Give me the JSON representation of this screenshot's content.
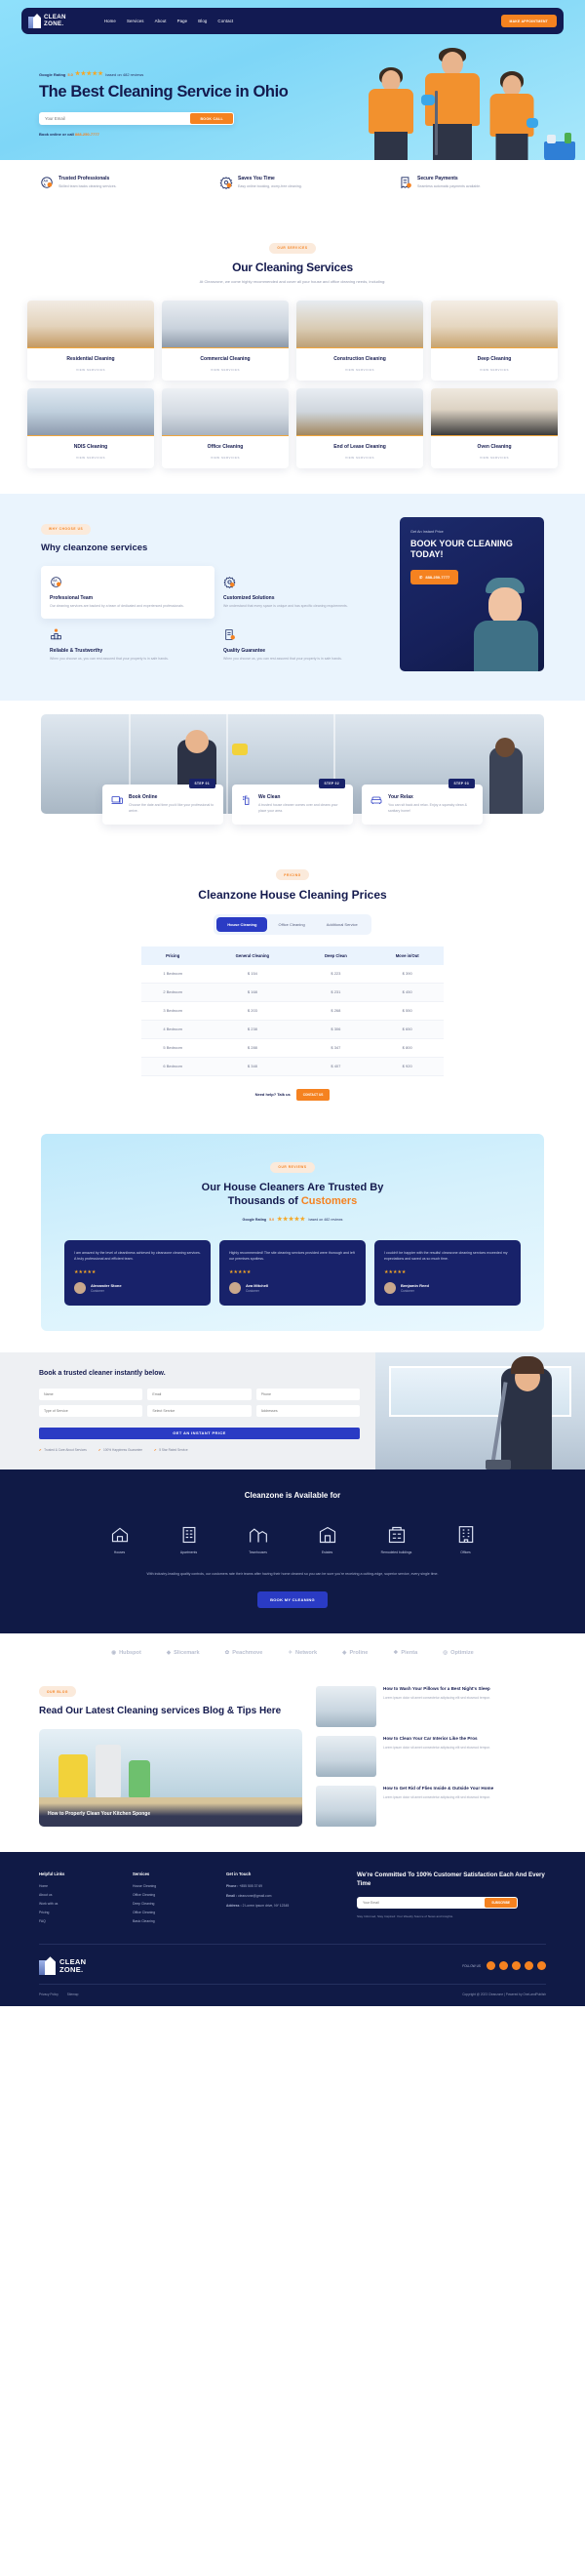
{
  "header": {
    "logo": {
      "line1": "CLEAN",
      "line2": "ZONE."
    },
    "nav": [
      {
        "label": "Home"
      },
      {
        "label": "Services"
      },
      {
        "label": "About"
      },
      {
        "label": "Page"
      },
      {
        "label": "Blog"
      },
      {
        "label": "Contact"
      }
    ],
    "cta": "MAKE APPOINTMENT"
  },
  "hero": {
    "rating_label": "Google Rating",
    "rating_value": "5.0",
    "stars": "★★★★★",
    "rating_sub": "based on 482 reviews",
    "title": "The Best Cleaning Service in Ohio",
    "email_placeholder": "Your Email",
    "book_button": "BOOK CALL",
    "call_prefix": "Book online or call",
    "phone": "888-250-7777"
  },
  "features": [
    {
      "icon": "badge-icon",
      "title": "Trusted Professionals",
      "desc": "Skilled team backs cleaning services."
    },
    {
      "icon": "gear-clock-icon",
      "title": "Saves You Time",
      "desc": "Easy online booking, worry-free cleaning."
    },
    {
      "icon": "receipt-icon",
      "title": "Secure Payments",
      "desc": "Seamless automatic payments available."
    }
  ],
  "services": {
    "pill": "OUR SERVICES",
    "title": "Our Cleaning Services",
    "desc": "At Cleanzone, we come highly recommended and cover all your house and office cleaning needs, including:",
    "view_label": "VIEW SERVICES",
    "items": [
      {
        "title": "Residential Cleaning",
        "thumb": "th-res"
      },
      {
        "title": "Commercial Cleaning",
        "thumb": "th-com"
      },
      {
        "title": "Construction Cleaning",
        "thumb": "th-con"
      },
      {
        "title": "Deep Cleaning",
        "thumb": "th-dep"
      },
      {
        "title": "NDIS Cleaning",
        "thumb": "th-ndis"
      },
      {
        "title": "Office Cleaning",
        "thumb": "th-off"
      },
      {
        "title": "End of Lease Cleaning",
        "thumb": "th-lease"
      },
      {
        "title": "Oven Cleaning",
        "thumb": "th-oven"
      }
    ]
  },
  "why": {
    "pill": "WHY CHOOSE US",
    "title": "Why cleanzone services",
    "items": [
      {
        "icon": "badge-icon",
        "title": "Professional Team",
        "desc": "Our cleaning services are backed by a team of dedicated and experienced professionals."
      },
      {
        "icon": "gear-clock-icon",
        "title": "Customized Solutions",
        "desc": "We understand that every space is unique and has specific cleaning requirements."
      },
      {
        "icon": "podium-icon",
        "title": "Reliable & Trustworthy",
        "desc": "When you choose us, you can rest assured that your property is in safe hands."
      },
      {
        "icon": "certificate-icon",
        "title": "Quality Guarantee",
        "desc": "When you choose us, you can rest assured that your property is in safe hands."
      }
    ],
    "promo": {
      "eyebrow": "Get An Instant Price",
      "title": "BOOK YOUR CLEANING TODAY!",
      "phone": "888-250-7777"
    }
  },
  "steps": [
    {
      "tag": "STEP 01",
      "icon": "laptop-icon",
      "title": "Book Online",
      "desc": "Choose the date and time you'd like your professional to arrive."
    },
    {
      "tag": "STEP 02",
      "icon": "spray-icon",
      "title": "We Clean",
      "desc": "A trusted house cleaner comes over and cleans your place your area."
    },
    {
      "tag": "STEP 03",
      "icon": "sofa-icon",
      "title": "Your Relax",
      "desc": "You can sit back and relax. Enjoy a squeaky clean & sanitary home!"
    }
  ],
  "pricing": {
    "pill": "PRICING",
    "title": "Cleanzone House Cleaning Prices",
    "tabs": [
      {
        "label": "House Cleaning",
        "active": true
      },
      {
        "label": "Office Cleaning",
        "active": false
      },
      {
        "label": "Additional Service",
        "active": false
      }
    ],
    "columns": [
      "Pricing",
      "General Cleaning",
      "Deep Clean",
      "Move in/Out"
    ],
    "rows": [
      [
        "1 Bedroom",
        "$ 154",
        "$ 223",
        "$ 390"
      ],
      [
        "2 Bedroom",
        "$ 168",
        "$ 231",
        "$ 450"
      ],
      [
        "3 Bedroom",
        "$ 203",
        "$ 268",
        "$ 550"
      ],
      [
        "4 Bedroom",
        "$ 238",
        "$ 306",
        "$ 650"
      ],
      [
        "5 Bedroom",
        "$ 288",
        "$ 347",
        "$ 800"
      ],
      [
        "6 Bedroom",
        "$ 348",
        "$ 407",
        "$ 920"
      ]
    ],
    "need_help": "Need help? Talk us",
    "need_help_button": "CONTACT US"
  },
  "testimonials": {
    "pill": "OUR REVIEWS",
    "title_1": "Our House Cleaners Are Trusted By",
    "title_2": "Thousands of ",
    "title_hl": "Customers",
    "rating_label": "Google Rating",
    "rating_value": "5.0",
    "stars": "★★★★★",
    "rating_sub": "based on 482 reviews",
    "cards": [
      {
        "text": "I am amazed by the level of cleanliness achieved by cleanzone cleaning services. A truly professional and efficient team.",
        "stars": "★★★★★",
        "name": "Alexander Stone",
        "role": "Customer"
      },
      {
        "text": "Highly recommended! The site cleaning services provided were thorough and left our premises spotless.",
        "stars": "★★★★★",
        "name": "Ava Mitchell",
        "role": "Customer"
      },
      {
        "text": "I couldn't be happier with the results! cleanzone cleaning services exceeded my expectations and saved us so much time.",
        "stars": "★★★★★",
        "name": "Benjamin Reed",
        "role": "Customer"
      }
    ]
  },
  "booking": {
    "title": "Book a trusted cleaner instantly below.",
    "fields": {
      "name": "Name",
      "email": "Email",
      "phone": "Phone",
      "service": "Type of Service",
      "date": "Select Service",
      "address": "Addresses"
    },
    "submit": "GET AN INSTANT PRICE",
    "badges": [
      "Trusted & Care About Services",
      "100% Happiness Guarantee",
      "5 Star Rated Service"
    ]
  },
  "available": {
    "title": "Cleanzone is Available for",
    "items": [
      {
        "icon": "house-icon",
        "label": "Houses"
      },
      {
        "icon": "apartment-icon",
        "label": "Apartments"
      },
      {
        "icon": "townhouse-icon",
        "label": "Townhouses"
      },
      {
        "icon": "estate-icon",
        "label": "Estates"
      },
      {
        "icon": "remodel-icon",
        "label": "Remodeled buildings"
      },
      {
        "icon": "office-icon",
        "label": "Offices"
      }
    ],
    "note": "With industry-leading quality controls, our customers rate their teams after having their home cleaned so you can be sure you're receiving a cutting-edge, superior service, every single time.",
    "button": "BOOK MY CLEANING"
  },
  "brands": [
    {
      "name": "Hubspot"
    },
    {
      "name": "Slicemark"
    },
    {
      "name": "Peachmove"
    },
    {
      "name": "Network"
    },
    {
      "name": "Proline"
    },
    {
      "name": "Pienta"
    },
    {
      "name": "Optimize"
    }
  ],
  "blog": {
    "pill": "OUR BLOG",
    "title": "Read Our Latest Cleaning services Blog & Tips Here",
    "feature_title": "How to Properly Clean Your Kitchen Sponge",
    "posts": [
      {
        "title": "How to Wash Your Pillows for a Best Night's Sleep",
        "desc": "Lorem ipsum dolor sit amet consectetur adipiscing elit sed eiusmod tempor."
      },
      {
        "title": "How to Clean Your Car Interior Like the Pros",
        "desc": "Lorem ipsum dolor sit amet consectetur adipiscing elit sed eiusmod tempor."
      },
      {
        "title": "How to Get Rid of Flies Inside & Outside Your Home",
        "desc": "Lorem ipsum dolor sit amet consectetur adipiscing elit sed eiusmod tempor."
      }
    ]
  },
  "footer": {
    "col1": {
      "title": "Helpful Links",
      "links": [
        "Home",
        "About us",
        "Work with us",
        "Pricing",
        "FAQ"
      ]
    },
    "col2": {
      "title": "Services",
      "links": [
        "House Cleaning",
        "Office Cleaning",
        "Deep Cleaning",
        "Office Cleaning",
        "Basic Cleaning"
      ]
    },
    "col3": {
      "title": "Get in Touch",
      "phone_label": "Phone :",
      "phone": "+855 505 37 69",
      "email_label": "Email :",
      "email": "cleanzone@gmail.com",
      "address_label": "Address :",
      "address": "2 Lorem ipsum drive, NY 12345"
    },
    "newsletter": {
      "title": "We're Committed To 100% Customer Satisfaction Each And Every Time",
      "placeholder": "Your Email",
      "button": "SUBSCRIBE",
      "note": "Stay Informed, Stay Inspired: Your Weekly Source of News and Insights."
    },
    "logo": {
      "line1": "CLEAN",
      "line2": "ZONE."
    },
    "follow_label": "FOLLOW US",
    "copyright": "Copyright @ 2023 Cleanzone | Powered by OneLandPublish",
    "bottom_links": [
      "Privacy Policy",
      "Sitemap"
    ]
  }
}
